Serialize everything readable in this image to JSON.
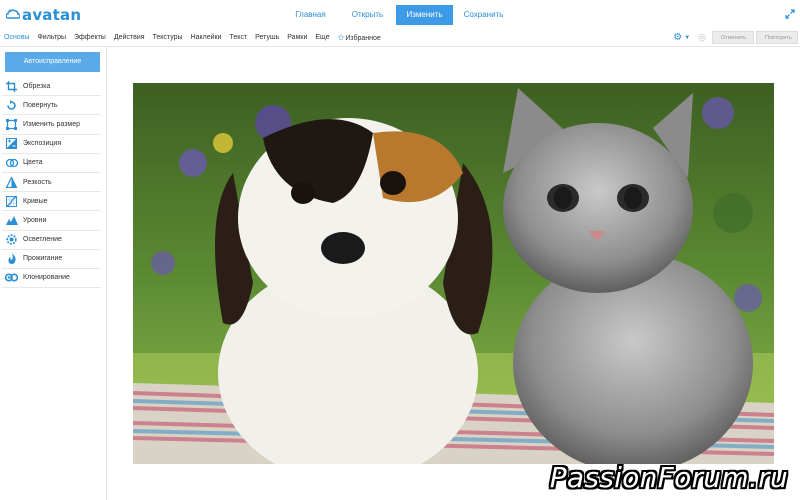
{
  "app": {
    "logo_text": "avatan"
  },
  "top_nav": [
    {
      "label": "Главная",
      "active": false
    },
    {
      "label": "Открыть",
      "active": false
    },
    {
      "label": "Изменить",
      "active": true
    },
    {
      "label": "Сохранить",
      "active": false
    }
  ],
  "tabs": [
    {
      "label": "Основы",
      "active": true
    },
    {
      "label": "Фильтры",
      "active": false
    },
    {
      "label": "Эффекты",
      "active": false
    },
    {
      "label": "Действия",
      "active": false
    },
    {
      "label": "Текстуры",
      "active": false
    },
    {
      "label": "Наклейки",
      "active": false
    },
    {
      "label": "Текст",
      "active": false
    },
    {
      "label": "Ретушь",
      "active": false
    },
    {
      "label": "Рамки",
      "active": false
    },
    {
      "label": "Еще",
      "active": false
    },
    {
      "label": "Избранное",
      "active": false
    }
  ],
  "toolbar": {
    "undo_label": "Отменить",
    "redo_label": "Повторить"
  },
  "sidebar": {
    "autofix_label": "Автоисправление",
    "tools": [
      {
        "label": "Обрезка",
        "icon": "crop-icon"
      },
      {
        "label": "Повернуть",
        "icon": "rotate-icon"
      },
      {
        "label": "Изменить размер",
        "icon": "resize-icon"
      },
      {
        "label": "Экспозиция",
        "icon": "exposure-icon"
      },
      {
        "label": "Цвета",
        "icon": "colors-icon"
      },
      {
        "label": "Резкость",
        "icon": "sharpness-icon"
      },
      {
        "label": "Кривые",
        "icon": "curves-icon"
      },
      {
        "label": "Уровни",
        "icon": "levels-icon"
      },
      {
        "label": "Осветление",
        "icon": "lighten-icon"
      },
      {
        "label": "Прожигание",
        "icon": "burn-icon"
      },
      {
        "label": "Клонирование",
        "icon": "clone-icon"
      }
    ]
  },
  "watermark": "PassionForum.ru",
  "colors": {
    "accent": "#2b8fd6",
    "active_button": "#3d9ae6",
    "autofix_button": "#5aa9e8"
  }
}
